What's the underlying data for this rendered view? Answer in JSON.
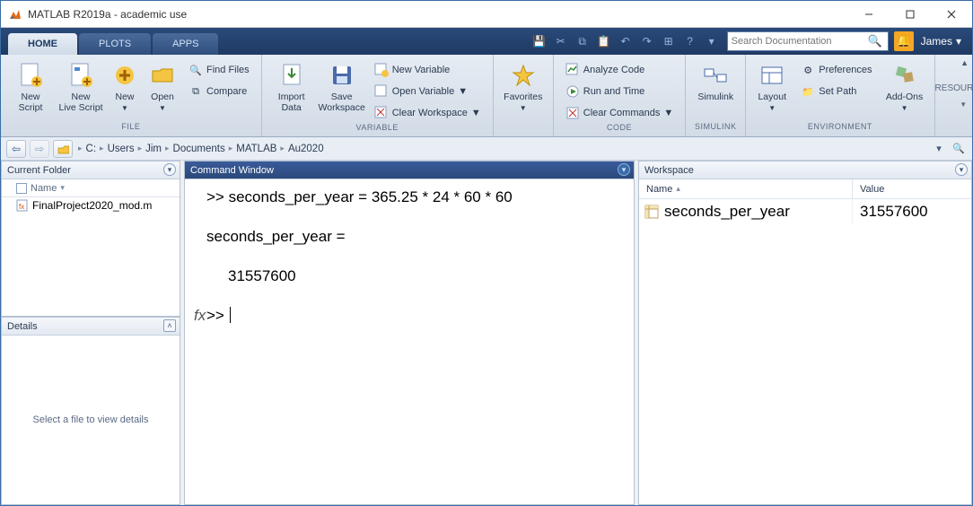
{
  "title": "MATLAB R2019a - academic use",
  "tabs": {
    "home": "HOME",
    "plots": "PLOTS",
    "apps": "APPS"
  },
  "search": {
    "placeholder": "Search Documentation"
  },
  "user": {
    "name": "James"
  },
  "ribbon": {
    "file": {
      "label": "FILE",
      "new_script": "New\nScript",
      "new_live": "New\nLive Script",
      "new": "New",
      "open": "Open",
      "find_files": "Find Files",
      "compare": "Compare"
    },
    "variable": {
      "label": "VARIABLE",
      "import": "Import\nData",
      "save_ws": "Save\nWorkspace",
      "new_var": "New Variable",
      "open_var": "Open Variable",
      "clear_ws": "Clear Workspace"
    },
    "favorites": "Favorites",
    "code": {
      "label": "CODE",
      "analyze": "Analyze Code",
      "run_time": "Run and Time",
      "clear_cmd": "Clear Commands"
    },
    "simulink": {
      "label": "SIMULINK",
      "btn": "Simulink"
    },
    "env": {
      "label": "ENVIRONMENT",
      "layout": "Layout",
      "prefs": "Preferences",
      "setpath": "Set Path",
      "addons": "Add-Ons"
    },
    "resources": "RESOURCES"
  },
  "path": {
    "segments": [
      "C:",
      "Users",
      "Jim",
      "Documents",
      "MATLAB",
      "Au2020"
    ]
  },
  "current_folder": {
    "title": "Current Folder",
    "name_col": "Name",
    "files": [
      "FinalProject2020_mod.m"
    ]
  },
  "details": {
    "title": "Details",
    "placeholder": "Select a file to view details"
  },
  "command_window": {
    "title": "Command Window",
    "input_line": ">> seconds_per_year = 365.25 * 24 * 60 * 60",
    "echo_line": "seconds_per_year =",
    "result": "31557600",
    "prompt": ">>"
  },
  "workspace": {
    "title": "Workspace",
    "name_col": "Name",
    "value_col": "Value",
    "vars": [
      {
        "name": "seconds_per_year",
        "value": "31557600"
      }
    ]
  }
}
